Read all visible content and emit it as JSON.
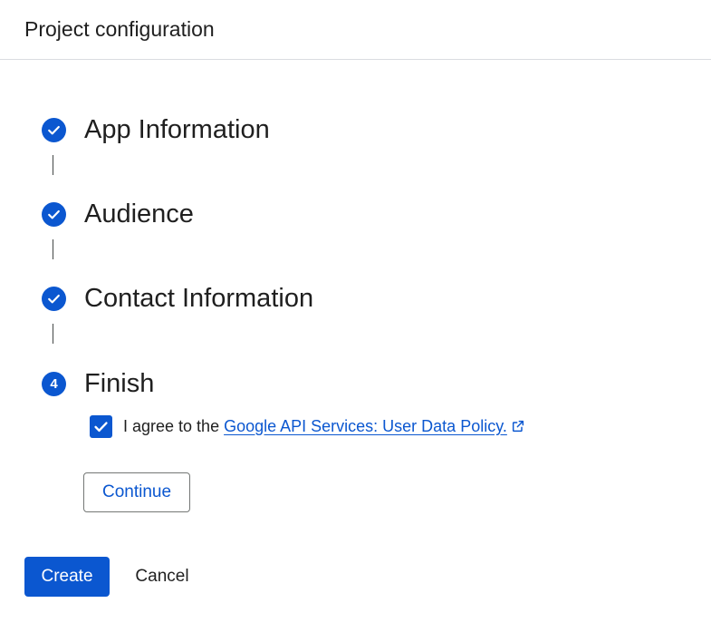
{
  "header": {
    "title": "Project configuration"
  },
  "steps": [
    {
      "label": "App Information",
      "status": "complete",
      "icon": "check-circle-icon"
    },
    {
      "label": "Audience",
      "status": "complete",
      "icon": "check-circle-icon"
    },
    {
      "label": "Contact Information",
      "status": "complete",
      "icon": "check-circle-icon"
    },
    {
      "label": "Finish",
      "status": "current",
      "number": "4"
    }
  ],
  "agreement": {
    "checked": true,
    "text": "I agree to the",
    "link_text": "Google API Services: User Data Policy.",
    "link_icon": "external-link-icon"
  },
  "buttons": {
    "continue_label": "Continue",
    "create_label": "Create",
    "cancel_label": "Cancel"
  },
  "colors": {
    "accent": "#0b57d0",
    "text": "#1f1f1f",
    "divider": "#dadce0"
  }
}
